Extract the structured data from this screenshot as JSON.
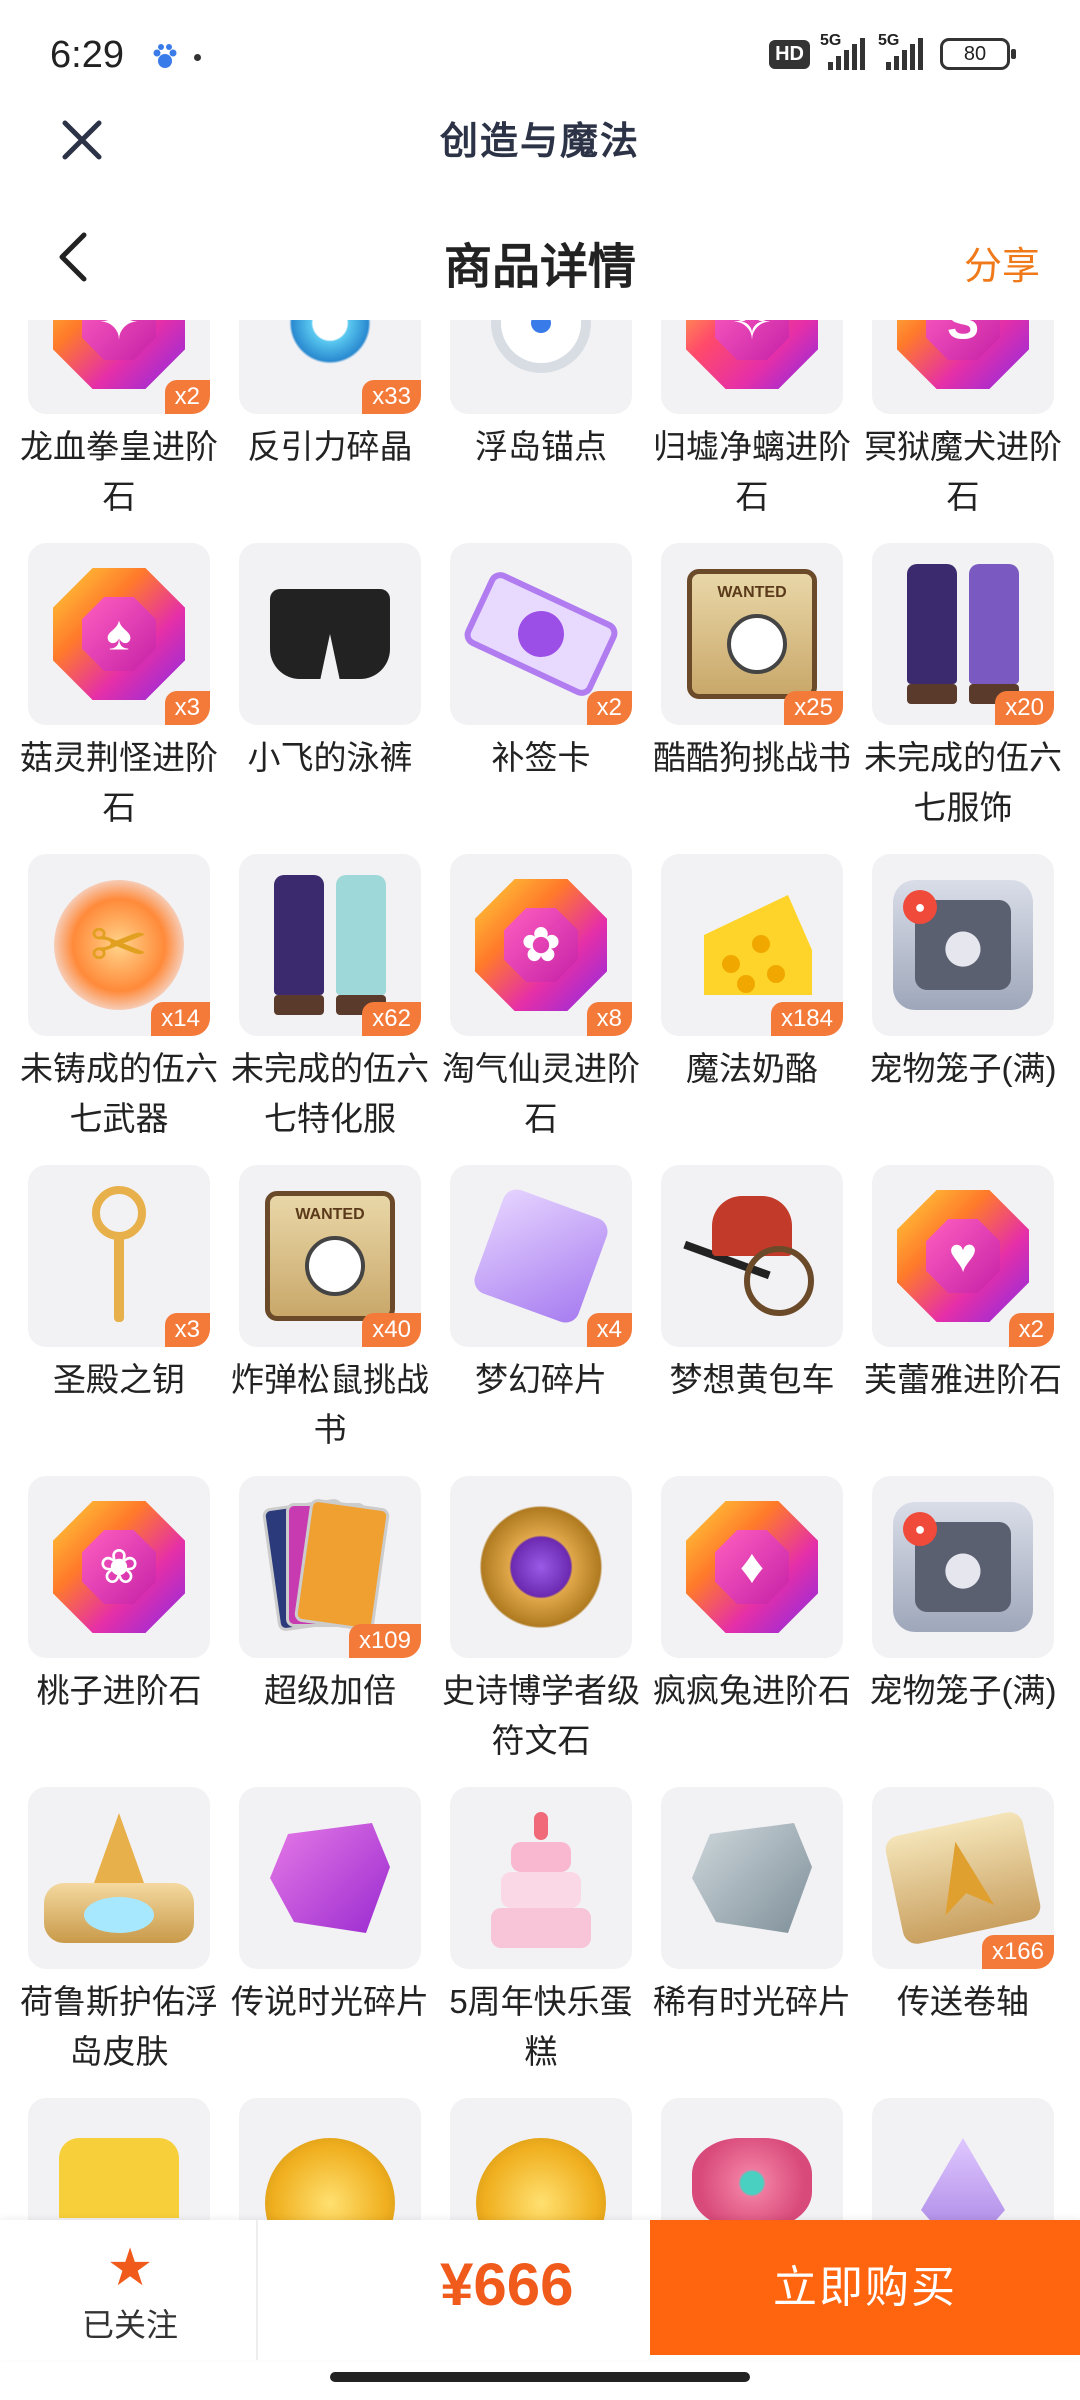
{
  "status_bar": {
    "time": "6:29",
    "hd": "HD",
    "network_1": "5G",
    "network_2": "5G",
    "battery": "80"
  },
  "web_bar": {
    "title": "创造与魔法"
  },
  "header": {
    "title": "商品详情",
    "share_label": "分享"
  },
  "items": [
    {
      "name": "龙血拳皇进阶石",
      "qty": "x2",
      "icon": "gem-icon"
    },
    {
      "name": "反引力碎晶",
      "qty": "x33",
      "icon": "crystal-icon"
    },
    {
      "name": "浮岛锚点",
      "qty": "",
      "icon": "anchor-icon"
    },
    {
      "name": "归墟净螭进阶石",
      "qty": "",
      "icon": "gem-icon"
    },
    {
      "name": "冥狱魔犬进阶石",
      "qty": "",
      "icon": "gem-icon"
    },
    {
      "name": "菇灵荆怪进阶石",
      "qty": "x3",
      "icon": "gem-icon"
    },
    {
      "name": "小飞的泳裤",
      "qty": "",
      "icon": "shorts-icon"
    },
    {
      "name": "补签卡",
      "qty": "x2",
      "icon": "ticket-icon"
    },
    {
      "name": "酷酷狗挑战书",
      "qty": "x25",
      "icon": "wanted-scroll-icon"
    },
    {
      "name": "未完成的伍六七服饰",
      "qty": "x20",
      "icon": "clothes-icon"
    },
    {
      "name": "未铸成的伍六七武器",
      "qty": "x14",
      "icon": "scissors-icon"
    },
    {
      "name": "未完成的伍六七特化服",
      "qty": "x62",
      "icon": "clothes-icon"
    },
    {
      "name": "淘气仙灵进阶石",
      "qty": "x8",
      "icon": "gem-icon"
    },
    {
      "name": "魔法奶酪",
      "qty": "x184",
      "icon": "cheese-icon"
    },
    {
      "name": "宠物笼子(满)",
      "qty": "",
      "icon": "pet-cage-icon"
    },
    {
      "name": "圣殿之钥",
      "qty": "x3",
      "icon": "key-icon"
    },
    {
      "name": "炸弹松鼠挑战书",
      "qty": "x40",
      "icon": "wanted-scroll-icon"
    },
    {
      "name": "梦幻碎片",
      "qty": "x4",
      "icon": "puzzle-icon"
    },
    {
      "name": "梦想黄包车",
      "qty": "",
      "icon": "rickshaw-icon"
    },
    {
      "name": "芙蕾雅进阶石",
      "qty": "x2",
      "icon": "gem-icon"
    },
    {
      "name": "桃子进阶石",
      "qty": "",
      "icon": "gem-icon"
    },
    {
      "name": "超级加倍",
      "qty": "x109",
      "icon": "cards-icon"
    },
    {
      "name": "史诗博学者级符文石",
      "qty": "",
      "icon": "rune-icon"
    },
    {
      "name": "疯疯兔进阶石",
      "qty": "",
      "icon": "gem-icon"
    },
    {
      "name": "宠物笼子(满)",
      "qty": "",
      "icon": "pet-cage-icon"
    },
    {
      "name": "荷鲁斯护佑浮岛皮肤",
      "qty": "",
      "icon": "island-icon"
    },
    {
      "name": "传说时光碎片",
      "qty": "",
      "icon": "fragment-icon"
    },
    {
      "name": "5周年快乐蛋糕",
      "qty": "",
      "icon": "cake-icon"
    },
    {
      "name": "稀有时光碎片",
      "qty": "",
      "icon": "fragment-icon"
    },
    {
      "name": "传送卷轴",
      "qty": "x166",
      "icon": "teleport-scroll-icon"
    },
    {
      "name": "",
      "qty": "",
      "icon": "shirt-icon"
    },
    {
      "name": "",
      "qty": "",
      "icon": "coin-icon"
    },
    {
      "name": "",
      "qty": "",
      "icon": "coin-icon"
    },
    {
      "name": "",
      "qty": "",
      "icon": "flower-icon"
    },
    {
      "name": "",
      "qty": "",
      "icon": "crystal-icon"
    }
  ],
  "bottom_bar": {
    "follow_label": "已关注",
    "price": "¥666",
    "buy_label": "立即购买"
  },
  "colors": {
    "accent": "#ff650f",
    "price": "#f05a1a",
    "qty_badge": "#f47a3a",
    "share": "#f07a1a"
  }
}
